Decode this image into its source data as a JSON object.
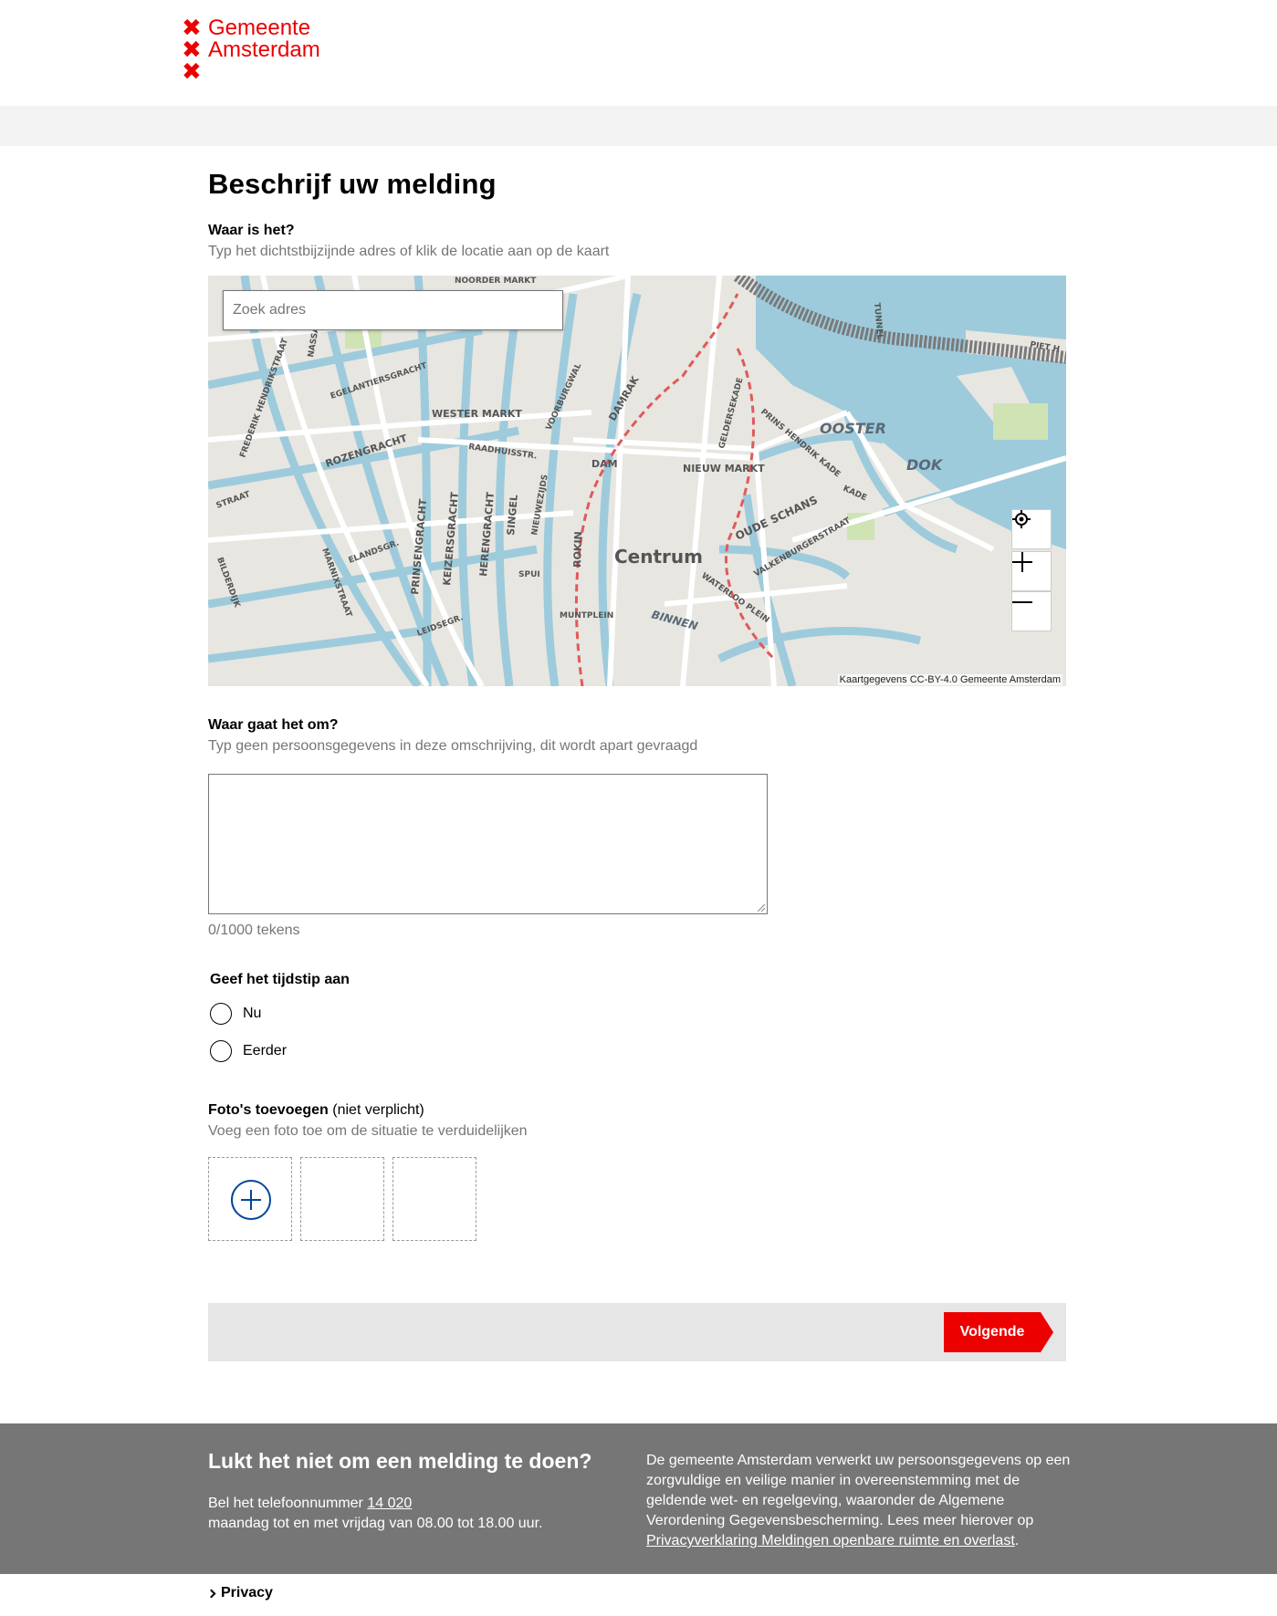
{
  "header": {
    "logo_line1": "Gemeente",
    "logo_line2": "Amsterdam",
    "logo_mark": "✖"
  },
  "form": {
    "title": "Beschrijf uw melding",
    "location": {
      "label": "Waar is het?",
      "hint": "Typ het dichtstbijzijnde adres of klik de locatie aan op de kaart",
      "search_placeholder": "Zoek adres",
      "map_labels": [
        "OOSTER",
        "DOK",
        "Centrum",
        "DAM",
        "WESTER MARKT",
        "NIEUW MARKT",
        "ROZENGRACHT",
        "PRINSENGRACHT",
        "KEIZERSGRACHT",
        "HERENGRACHT",
        "SINGEL",
        "DAMRAK",
        "ROKIN",
        "OUDE SCHANS",
        "BINNEN",
        "MUNTPLEIN",
        "SPUI",
        "LEIDSEGR.",
        "RAADHUISSTR.",
        "EGELANTIERSGRACHT",
        "MARNIXSTRAAT",
        "NIEUWEZIJDS",
        "VALKENBURGERSTRAAT",
        "PRINS HENDRIK KADE",
        "GELDERSEKADE",
        "VOORBURGWAL",
        "ELANDSGR.",
        "NOORDER MARKT",
        "FREDERIK HENDRIKSTRAAT",
        "BILDERDIJK",
        "WATERLOO PLEIN",
        "KADE",
        "PIET H",
        "TUNNEL",
        "STRAAT",
        "NASSAU"
      ],
      "attribution": "Kaartgegevens CC-BY-4.0 Gemeente Amsterdam",
      "controls": [
        "locate-icon",
        "zoom-in-icon",
        "zoom-out-icon"
      ]
    },
    "description": {
      "label": "Waar gaat het om?",
      "hint": "Typ geen persoonsgegevens in deze omschrijving, dit wordt apart gevraagd",
      "value": "",
      "char_count": "0/1000 tekens"
    },
    "time": {
      "label": "Geef het tijdstip aan",
      "options": [
        {
          "label": "Nu",
          "selected": false
        },
        {
          "label": "Eerder",
          "selected": false
        }
      ]
    },
    "photos": {
      "label": "Foto's toevoegen",
      "optional": "(niet verplicht)",
      "hint": "Voeg een foto toe om de situatie te verduidelijken"
    },
    "next_label": "Volgende"
  },
  "footer": {
    "title": "Lukt het niet om een melding te doen?",
    "phone_prefix": "Bel het telefoonnummer",
    "phone": "14 020",
    "hours": "maandag tot en met vrijdag van 08.00 tot 18.00 uur.",
    "privacy_text": "De gemeente Amsterdam verwerkt uw persoonsgegevens op een zorgvuldige en veilige manier in overeenstemming met de geldende wet- en regelgeving, waaronder de Algemene Verordening Gegevensbescherming. Lees meer hierover op",
    "privacy_link": "Privacyverklaring Meldingen openbare ruimte en overlast",
    "privacy_end": "."
  },
  "bottom_link": "Privacy",
  "colors": {
    "brand_red": "#ec0000",
    "water": "#9dcbdc",
    "text_muted": "#767676",
    "footer_bg": "#767676",
    "accent_blue": "#004699"
  }
}
